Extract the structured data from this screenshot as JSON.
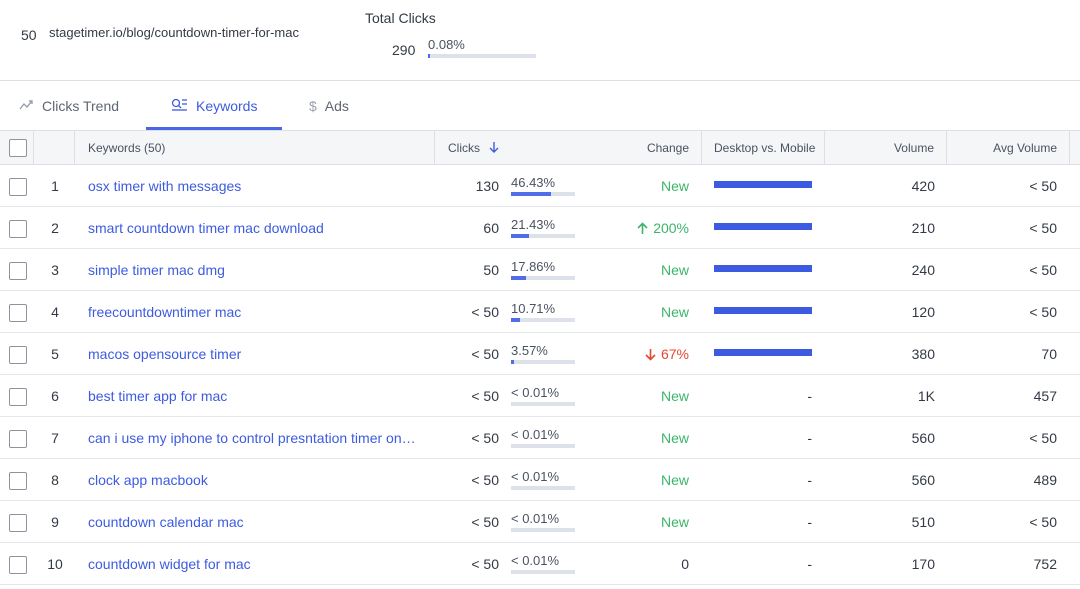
{
  "summary": {
    "rank": "50",
    "url": "stagetimer.io/blog/countdown-timer-for-mac",
    "total_clicks_label": "Total Clicks",
    "total_clicks_value": "290",
    "total_clicks_pct": "0.08%",
    "total_clicks_pct_fraction": 0.08
  },
  "tabs": [
    {
      "label": "Clicks Trend",
      "icon": "trend-icon",
      "active": false
    },
    {
      "label": "Keywords",
      "icon": "keywords-icon",
      "active": true
    },
    {
      "label": "Ads",
      "icon": "dollar-icon",
      "active": false
    }
  ],
  "table": {
    "headers": {
      "keywords": "Keywords (50)",
      "clicks": "Clicks",
      "clicks_sort_icon": "arrow-down-icon",
      "change": "Change",
      "desktop_mobile": "Desktop vs. Mobile",
      "volume": "Volume",
      "avg_volume": "Avg Volume"
    },
    "rows": [
      {
        "index": "1",
        "keyword": "osx timer with messages",
        "clicks": "130",
        "pct": "46.43%",
        "pct_fraction": 0.4643,
        "change": "New",
        "change_type": "new",
        "desktop_fraction": 1.0,
        "desktop_text": "",
        "volume": "420",
        "avg_volume": "< 50"
      },
      {
        "index": "2",
        "keyword": "smart countdown timer mac download",
        "clicks": "60",
        "pct": "21.43%",
        "pct_fraction": 0.2143,
        "change": "200%",
        "change_type": "up",
        "desktop_fraction": 1.0,
        "desktop_text": "",
        "volume": "210",
        "avg_volume": "< 50"
      },
      {
        "index": "3",
        "keyword": "simple timer mac dmg",
        "clicks": "50",
        "pct": "17.86%",
        "pct_fraction": 0.1786,
        "change": "New",
        "change_type": "new",
        "desktop_fraction": 1.0,
        "desktop_text": "",
        "volume": "240",
        "avg_volume": "< 50"
      },
      {
        "index": "4",
        "keyword": "freecountdowntimer mac",
        "clicks": "< 50",
        "pct": "10.71%",
        "pct_fraction": 0.1071,
        "change": "New",
        "change_type": "new",
        "desktop_fraction": 1.0,
        "desktop_text": "",
        "volume": "120",
        "avg_volume": "< 50"
      },
      {
        "index": "5",
        "keyword": "macos opensource timer",
        "clicks": "< 50",
        "pct": "3.57%",
        "pct_fraction": 0.0357,
        "change": "67%",
        "change_type": "down",
        "desktop_fraction": 1.0,
        "desktop_text": "",
        "volume": "380",
        "avg_volume": "70"
      },
      {
        "index": "6",
        "keyword": "best timer app for mac",
        "clicks": "< 50",
        "pct": "< 0.01%",
        "pct_fraction": 0,
        "change": "New",
        "change_type": "new",
        "desktop_fraction": null,
        "desktop_text": "-",
        "volume": "1K",
        "avg_volume": "457"
      },
      {
        "index": "7",
        "keyword": "can i use my iphone to control presntation timer on mac",
        "clicks": "< 50",
        "pct": "< 0.01%",
        "pct_fraction": 0,
        "change": "New",
        "change_type": "new",
        "desktop_fraction": null,
        "desktop_text": "-",
        "volume": "560",
        "avg_volume": "< 50"
      },
      {
        "index": "8",
        "keyword": "clock app macbook",
        "clicks": "< 50",
        "pct": "< 0.01%",
        "pct_fraction": 0,
        "change": "New",
        "change_type": "new",
        "desktop_fraction": null,
        "desktop_text": "-",
        "volume": "560",
        "avg_volume": "489"
      },
      {
        "index": "9",
        "keyword": "countdown calendar mac",
        "clicks": "< 50",
        "pct": "< 0.01%",
        "pct_fraction": 0,
        "change": "New",
        "change_type": "new",
        "desktop_fraction": null,
        "desktop_text": "-",
        "volume": "510",
        "avg_volume": "< 50"
      },
      {
        "index": "10",
        "keyword": "countdown widget for mac",
        "clicks": "< 50",
        "pct": "< 0.01%",
        "pct_fraction": 0,
        "change": "0",
        "change_type": "neutral",
        "desktop_fraction": null,
        "desktop_text": "-",
        "volume": "170",
        "avg_volume": "752"
      }
    ]
  },
  "colors": {
    "accent": "#3d5be0",
    "positive": "#3bb56a",
    "negative": "#e5482f"
  }
}
